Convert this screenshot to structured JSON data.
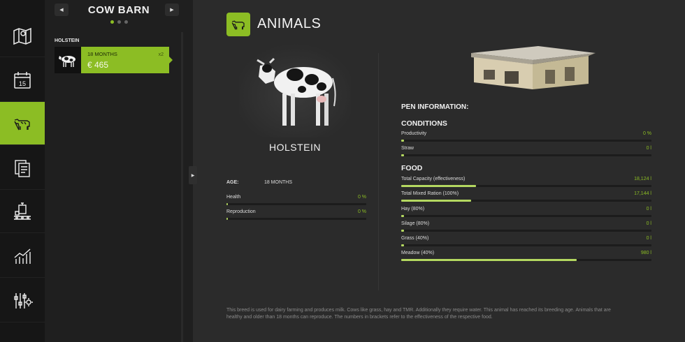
{
  "nav": {
    "items": [
      {
        "icon": "map-icon"
      },
      {
        "icon": "calendar-icon",
        "badge": "15"
      },
      {
        "icon": "cow-icon"
      },
      {
        "icon": "contracts-icon"
      },
      {
        "icon": "production-icon"
      },
      {
        "icon": "stats-icon"
      },
      {
        "icon": "settings-icon"
      }
    ]
  },
  "panel": {
    "prev_label": "◀",
    "next_label": "▶",
    "title": "COW BARN",
    "group_label": "HOLSTEIN",
    "card": {
      "age": "18 MONTHS",
      "price": "€ 465",
      "count": "x2"
    },
    "collapse_label": "▶"
  },
  "main": {
    "section_title": "ANIMALS",
    "animal_name": "HOLSTEIN",
    "age_label": "AGE:",
    "age_value": "18 MONTHS",
    "animal_stats": [
      {
        "label": "Health",
        "value": "0 %",
        "fraction": 0.0
      },
      {
        "label": "Reproduction",
        "value": "0 %",
        "fraction": 0.0
      }
    ],
    "pen_info_title": "PEN INFORMATION:",
    "conditions_title": "CONDITIONS",
    "conditions": [
      {
        "label": "Productivity",
        "value": "0 %",
        "fraction": 0.0
      },
      {
        "label": "Straw",
        "value": "0 l",
        "fraction": 0.0
      }
    ],
    "food_title": "FOOD",
    "food": [
      {
        "label": "Total Capacity (effectiveness)",
        "value": "18,124 l",
        "fraction": 0.3
      },
      {
        "label": "Total Mixed Ration (100%)",
        "value": "17,144 l",
        "fraction": 0.28
      },
      {
        "label": "Hay (80%)",
        "value": "0 l",
        "fraction": 0.0
      },
      {
        "label": "Silage (80%)",
        "value": "0 l",
        "fraction": 0.0
      },
      {
        "label": "Grass (40%)",
        "value": "0 l",
        "fraction": 0.0
      },
      {
        "label": "Meadow (40%)",
        "value": "980 l",
        "fraction": 0.7
      }
    ],
    "footnote": "This breed is used for dairy farming and produces milk. Cows like grass, hay and TMR. Additionally they require water. This animal has reached its breeding age. Animals that are healthy and older than 18 months can reproduce. The numbers in brackets refer to the effectiveness of the respective food."
  },
  "colors": {
    "accent": "#8cbd24",
    "bar_fill": "#b4d860",
    "value_text": "#8cbd24",
    "background": "#2b2b2b",
    "nav_background": "#161616"
  }
}
